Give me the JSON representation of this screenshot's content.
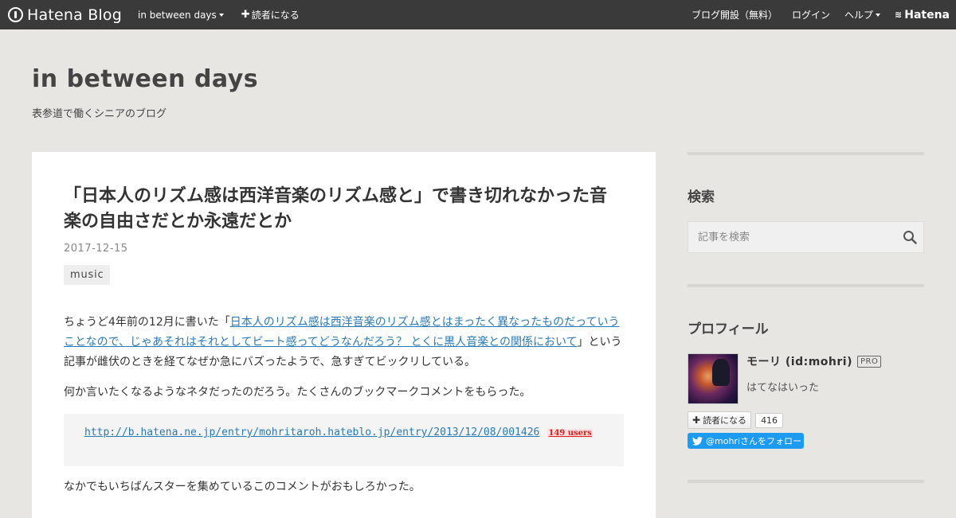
{
  "global_bar": {
    "logo_text": "Hatena Blog",
    "blog_menu_label": "in between days",
    "subscribe_label": "読者になる",
    "open_blog_label": "ブログ開設（無料）",
    "login_label": "ログイン",
    "help_label": "ヘルプ",
    "hatena_label": "Hatena"
  },
  "blog": {
    "title": "in between days",
    "description": "表参道で働くシニアのブログ"
  },
  "entry": {
    "title": "「日本人のリズム感は西洋音楽のリズム感と」で書き切れなかった音楽の自由さだとか永遠だとか",
    "date": "2017-12-15",
    "category": "music",
    "p1_before": "ちょうど4年前の12月に書いた「",
    "p1_link": "日本人のリズム感は西洋音楽のリズム感とはまったく異なったものだっていうことなので、じゃあそれはそれとしてビート感ってどうなんだろう？ とくに黒人音楽との関係において",
    "p1_after": "」という記事が雌伏のときを経てなぜか急にバズったようで、急すぎてビックリしている。",
    "p2": "何か言いたくなるようなネタだったのだろう。たくさんのブックマークコメントをもらった。",
    "quote_url": "http://b.hatena.ne.jp/entry/mohritaroh.hateblo.jp/entry/2013/12/08/001426",
    "quote_users": "149 users",
    "p3": "なかでもいちばんスターを集めているこのコメントがおもしろかった。"
  },
  "sidebar": {
    "search_heading": "検索",
    "search_placeholder": "記事を検索",
    "profile_heading": "プロフィール",
    "profile_name": "モーリ (id:mohri)",
    "pro_badge": "PRO",
    "profile_sub": "はてなはいった",
    "reader_button": "読者になる",
    "reader_count": "416",
    "twitter_button": "@mohriさんをフォロー"
  },
  "colors": {
    "global_bar": "#3a3a3a",
    "background": "#e8e6e2",
    "link": "#2a7ab8",
    "twitter": "#1d9bf0"
  }
}
